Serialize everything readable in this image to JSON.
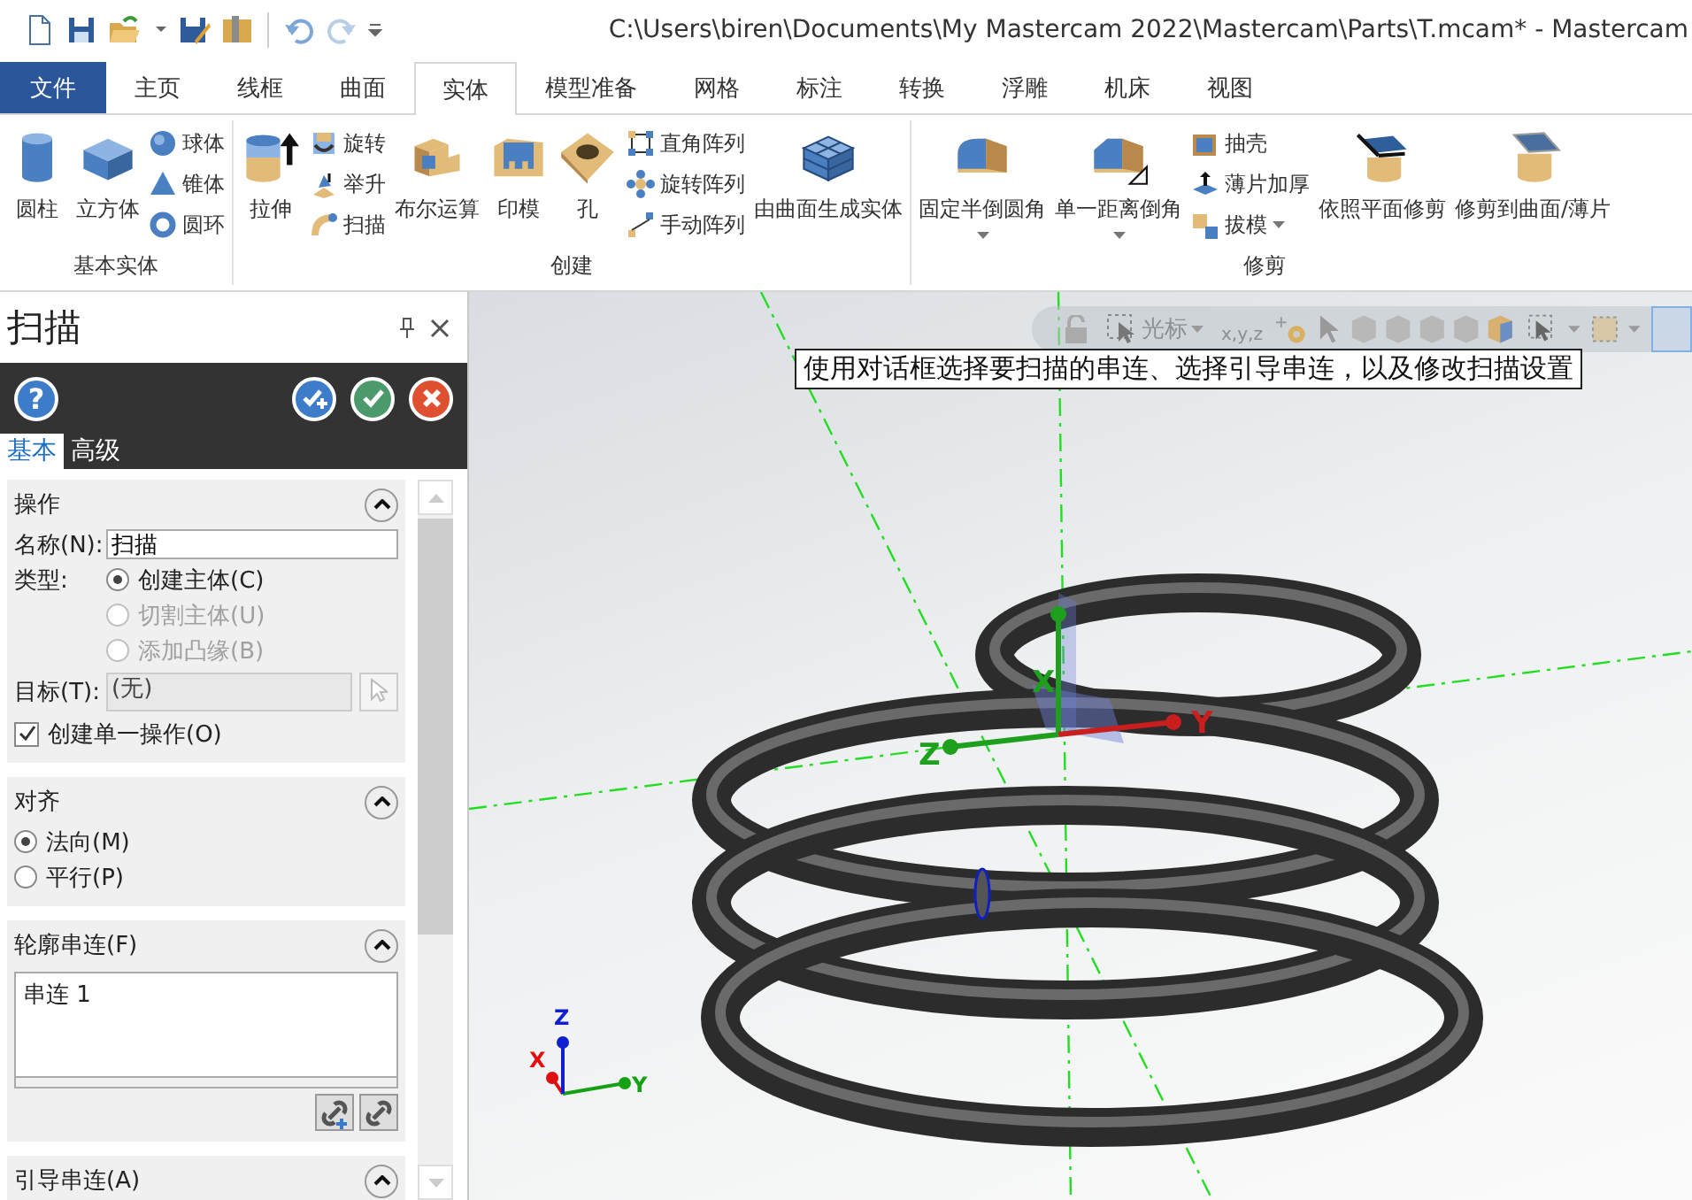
{
  "window": {
    "title": "C:\\Users\\biren\\Documents\\My Mastercam 2022\\Mastercam\\Parts\\T.mcam* - Mastercam"
  },
  "tabs": [
    {
      "label": "文件",
      "kind": "backstage",
      "selected": false
    },
    {
      "label": "主页",
      "kind": "tab",
      "selected": false
    },
    {
      "label": "线框",
      "kind": "tab",
      "selected": false
    },
    {
      "label": "曲面",
      "kind": "tab",
      "selected": false
    },
    {
      "label": "实体",
      "kind": "tab",
      "selected": true
    },
    {
      "label": "模型准备",
      "kind": "tab",
      "selected": false
    },
    {
      "label": "网格",
      "kind": "tab",
      "selected": false
    },
    {
      "label": "标注",
      "kind": "tab",
      "selected": false
    },
    {
      "label": "转换",
      "kind": "tab",
      "selected": false
    },
    {
      "label": "浮雕",
      "kind": "tab",
      "selected": false
    },
    {
      "label": "机床",
      "kind": "tab",
      "selected": false
    },
    {
      "label": "视图",
      "kind": "tab",
      "selected": false
    }
  ],
  "ribbon": {
    "groups": [
      {
        "label": "基本实体",
        "items": [
          {
            "label": "圆柱",
            "kind": "large",
            "has_menu": false
          },
          {
            "label": "立方体",
            "kind": "large",
            "has_menu": false
          },
          {
            "label": "球体",
            "kind": "small",
            "has_menu": false
          },
          {
            "label": "锥体",
            "kind": "small",
            "has_menu": false
          },
          {
            "label": "圆环",
            "kind": "small",
            "has_menu": false
          }
        ]
      },
      {
        "label": "创建",
        "items": [
          {
            "label": "拉伸",
            "kind": "large",
            "has_menu": false
          },
          {
            "label": "旋转",
            "kind": "small",
            "has_menu": false
          },
          {
            "label": "举升",
            "kind": "small",
            "has_menu": false
          },
          {
            "label": "扫描",
            "kind": "small",
            "has_menu": false
          },
          {
            "label": "布尔运算",
            "kind": "large",
            "has_menu": false
          },
          {
            "label": "印模",
            "kind": "large",
            "has_menu": false
          },
          {
            "label": "孔",
            "kind": "large",
            "has_menu": false
          },
          {
            "label": "直角阵列",
            "kind": "small",
            "has_menu": false
          },
          {
            "label": "旋转阵列",
            "kind": "small",
            "has_menu": false
          },
          {
            "label": "手动阵列",
            "kind": "small",
            "has_menu": false
          },
          {
            "label": "由曲面生成实体",
            "kind": "large",
            "has_menu": false
          }
        ]
      },
      {
        "label": "修剪",
        "items": [
          {
            "label": "固定半倒圆角",
            "kind": "large",
            "has_menu": true
          },
          {
            "label": "单一距离倒角",
            "kind": "large",
            "has_menu": true
          },
          {
            "label": "抽壳",
            "kind": "small",
            "has_menu": false
          },
          {
            "label": "薄片加厚",
            "kind": "small",
            "has_menu": false
          },
          {
            "label": "拔模",
            "kind": "small",
            "has_menu": true
          },
          {
            "label": "依照平面修剪",
            "kind": "large",
            "has_menu": false
          },
          {
            "label": "修剪到曲面/薄片",
            "kind": "large",
            "has_menu": false
          }
        ]
      }
    ]
  },
  "panel": {
    "title": "扫描",
    "help_button": "?",
    "tabs": [
      {
        "label": "基本",
        "selected": true
      },
      {
        "label": "高级",
        "selected": false
      }
    ],
    "sections": [
      {
        "title": "操作",
        "expanded": true,
        "rows": [
          {
            "kind": "field",
            "label": "名称(N):",
            "value": "扫描"
          },
          {
            "kind": "radio",
            "label": "类型:",
            "text": "创建主体(C)",
            "selected": true,
            "disabled": false
          },
          {
            "kind": "radio",
            "text": "切割主体(U)",
            "selected": false,
            "disabled": true
          },
          {
            "kind": "radio",
            "text": "添加凸缘(B)",
            "selected": false,
            "disabled": true
          },
          {
            "kind": "target",
            "label": "目标(T):",
            "value": "(无)",
            "disabled": true
          },
          {
            "kind": "checkbox",
            "text": "创建单一操作(O)",
            "checked": true
          }
        ]
      },
      {
        "title": "对齐",
        "expanded": true,
        "rows": [
          {
            "kind": "radio",
            "text": "法向(M)",
            "selected": true,
            "disabled": false
          },
          {
            "kind": "radio",
            "text": "平行(P)",
            "selected": false,
            "disabled": false
          }
        ]
      },
      {
        "title": "轮廓串连(F)",
        "expanded": true,
        "rows": [
          {
            "kind": "list",
            "items": [
              "串连 1"
            ]
          }
        ]
      },
      {
        "title": "引导串连(A)",
        "expanded": true
      }
    ]
  },
  "viewport": {
    "toolbar": {
      "selection_label": "光标",
      "coordinate_label": "x,y,z"
    },
    "tooltip": "使用对话框选择要扫描的串连、选择引导串连，以及修改扫描设置",
    "gizmo": [
      {
        "label": "X",
        "color": "#1ea01e"
      },
      {
        "label": "Y",
        "color": "#c81e1e"
      },
      {
        "label": "Z",
        "color": "#1ea01e"
      }
    ],
    "triad": [
      {
        "label": "X",
        "color": "#e01010"
      },
      {
        "label": "Y",
        "color": "#16a016"
      },
      {
        "label": "Z",
        "color": "#1020d0"
      }
    ]
  }
}
